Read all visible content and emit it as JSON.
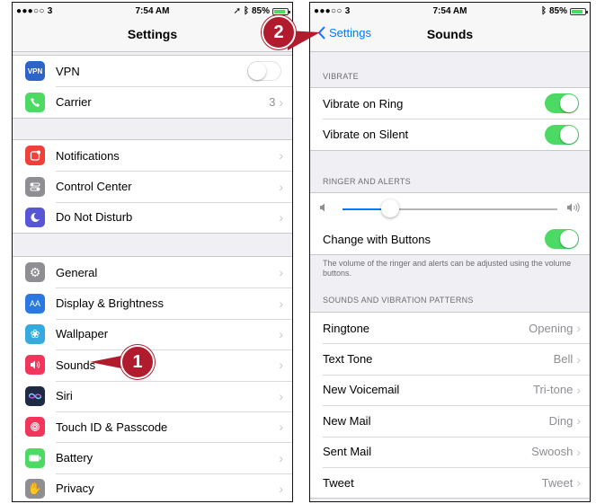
{
  "left": {
    "status": {
      "carrier": "●●●○○ 3 ",
      "time": "7:54 AM",
      "battery": "85%",
      "battery_level": 0.85
    },
    "title": "Settings",
    "group1": [
      {
        "label": "VPN",
        "icon": "vpn-icon",
        "color": "#2e63c9",
        "toggle": "off"
      },
      {
        "label": "Carrier",
        "icon": "phone-icon",
        "color": "#4cd964",
        "value": "3"
      }
    ],
    "group2": [
      {
        "label": "Notifications",
        "icon": "notifications-icon",
        "color": "#f0403a"
      },
      {
        "label": "Control Center",
        "icon": "control-center-icon",
        "color": "#8e8e93"
      },
      {
        "label": "Do Not Disturb",
        "icon": "moon-icon",
        "color": "#5856d6"
      }
    ],
    "group3": [
      {
        "label": "General",
        "icon": "gear-icon",
        "color": "#8e8e93"
      },
      {
        "label": "Display & Brightness",
        "icon": "display-icon",
        "color": "#2a79e0"
      },
      {
        "label": "Wallpaper",
        "icon": "wallpaper-icon",
        "color": "#35aadc"
      },
      {
        "label": "Sounds",
        "icon": "speaker-icon",
        "color": "#f2355b"
      },
      {
        "label": "Siri",
        "icon": "siri-icon",
        "color": "#1f2a44"
      },
      {
        "label": "Touch ID & Passcode",
        "icon": "fingerprint-icon",
        "color": "#f2355b"
      },
      {
        "label": "Battery",
        "icon": "battery-icon",
        "color": "#4cd964"
      },
      {
        "label": "Privacy",
        "icon": "hand-icon",
        "color": "#8e8e93"
      }
    ],
    "callout": "1"
  },
  "right": {
    "status": {
      "carrier": "●●●○○ 3 ",
      "time": "7:54 AM",
      "battery": "85%",
      "battery_level": 0.85
    },
    "back": "Settings",
    "title": "Sounds",
    "vibrate_header": "VIBRATE",
    "vibrate": [
      {
        "label": "Vibrate on Ring",
        "toggle": "on"
      },
      {
        "label": "Vibrate on Silent",
        "toggle": "on"
      }
    ],
    "ringer_header": "RINGER AND ALERTS",
    "ringer_level": 0.22,
    "change_with_buttons": {
      "label": "Change with Buttons",
      "toggle": "on"
    },
    "ringer_footer": "The volume of the ringer and alerts can be adjusted using the volume buttons.",
    "patterns_header": "SOUNDS AND VIBRATION PATTERNS",
    "patterns": [
      {
        "label": "Ringtone",
        "value": "Opening"
      },
      {
        "label": "Text Tone",
        "value": "Bell"
      },
      {
        "label": "New Voicemail",
        "value": "Tri-tone"
      },
      {
        "label": "New Mail",
        "value": "Ding"
      },
      {
        "label": "Sent Mail",
        "value": "Swoosh"
      },
      {
        "label": "Tweet",
        "value": "Tweet"
      }
    ],
    "callout": "2"
  },
  "colors": {
    "accent": "#007aff",
    "toggle_on": "#4cd964",
    "callout": "#b01c2e"
  }
}
